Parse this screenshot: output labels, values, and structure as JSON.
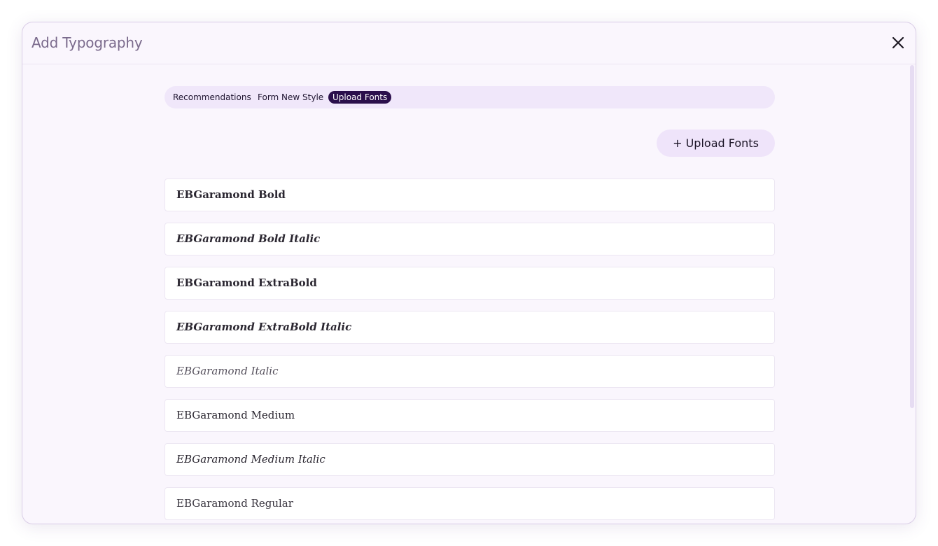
{
  "modal": {
    "title": "Add Typography"
  },
  "tabs": [
    {
      "label": "Recommendations",
      "active": false
    },
    {
      "label": "Form New Style",
      "active": false
    },
    {
      "label": "Upload Fonts",
      "active": true
    }
  ],
  "upload_button": {
    "label": "+ Upload Fonts"
  },
  "fonts": [
    {
      "name": "EBGaramond Bold",
      "weight": "bold",
      "style": "normal"
    },
    {
      "name": "EBGaramond Bold Italic",
      "weight": "bold",
      "style": "italic"
    },
    {
      "name": "EBGaramond ExtraBold",
      "weight": "bold",
      "style": "normal"
    },
    {
      "name": "EBGaramond ExtraBold Italic",
      "weight": "bold",
      "style": "italic"
    },
    {
      "name": "EBGaramond Italic",
      "weight": "normal",
      "style": "italic"
    },
    {
      "name": "EBGaramond Medium",
      "weight": "normal",
      "style": "normal"
    },
    {
      "name": "EBGaramond Medium Italic",
      "weight": "normal",
      "style": "italic"
    },
    {
      "name": "EBGaramond Regular",
      "weight": "normal",
      "style": "normal"
    }
  ],
  "icons": {
    "close": "close-icon"
  },
  "colors": {
    "accent": "#2b0f4c",
    "tab_bar": "#f0e7fa",
    "title": "#7a6a8c"
  }
}
